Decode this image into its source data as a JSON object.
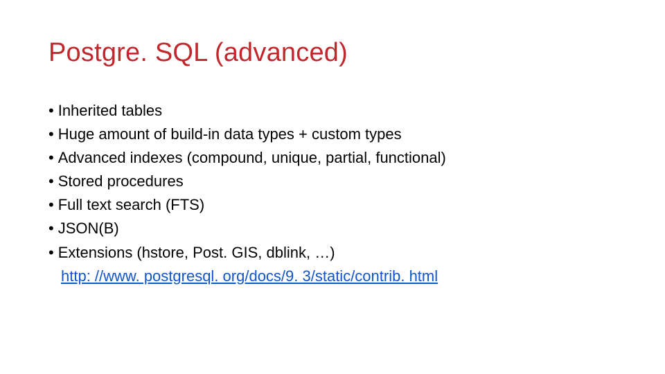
{
  "title": "Postgre. SQL (advanced)",
  "bullets": [
    "Inherited tables",
    "Huge amount of build-in data types + custom types",
    "Advanced indexes (compound, unique, partial, functional)",
    "Stored procedures",
    "Full text search (FTS)",
    "JSON(B)",
    "Extensions (hstore, Post. GIS, dblink, …)"
  ],
  "link_text": "http: //www. postgresql. org/docs/9. 3/static/contrib. html"
}
